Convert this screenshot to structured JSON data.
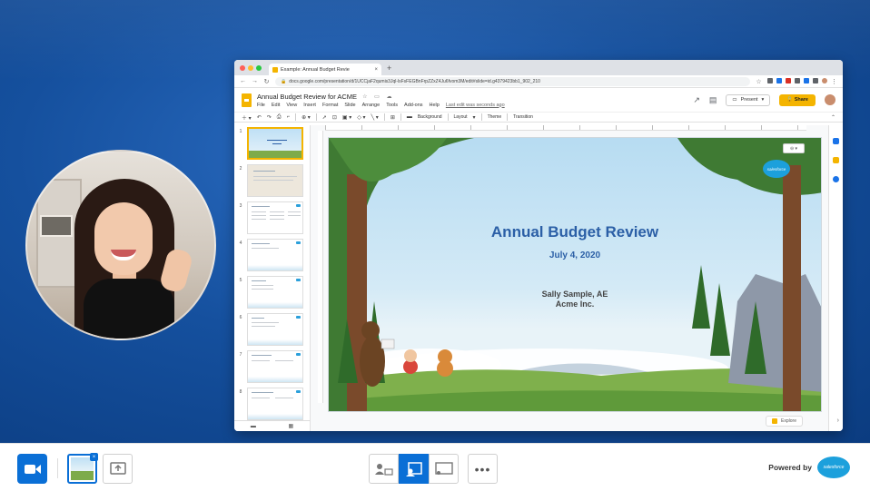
{
  "browser": {
    "tab_title": "Example: Annual Budget Revie",
    "tab_close": "×",
    "new_tab": "+",
    "url": "docs.google.com/presentation/d/1UCCjaF2qumis3Jql-lsFsFEGBnFrpZZxZ4Ju6fvom3M/edit#slide=id.g4379423bb1_902_210"
  },
  "doc": {
    "title": "Annual Budget Review for ACME",
    "menu": [
      "File",
      "Edit",
      "View",
      "Insert",
      "Format",
      "Slide",
      "Arrange",
      "Tools",
      "Add-ons",
      "Help"
    ],
    "last_edit": "Last edit was seconds ago",
    "present_label": "Present",
    "share_label": "Share"
  },
  "toolbar": {
    "background": "Background",
    "layout": "Layout",
    "theme": "Theme",
    "transition": "Transition"
  },
  "filmstrip": {
    "slide_numbers": [
      "1",
      "2",
      "3",
      "4",
      "5",
      "6",
      "7",
      "8"
    ]
  },
  "slide": {
    "title": "Annual Budget Review",
    "date": "July 4, 2020",
    "presenter_name": "Sally Sample, AE",
    "company": "Acme Inc.",
    "logo_text": "salesforce"
  },
  "explore_label": "Explore",
  "controlbar": {
    "powered_by": "Powered by",
    "logo_text": "salesforce"
  },
  "colors": {
    "brand_blue": "#0a6fd6",
    "slides_yellow": "#f4b400",
    "title_blue": "#2b5fa6",
    "salesforce_blue": "#1ca0dc"
  }
}
